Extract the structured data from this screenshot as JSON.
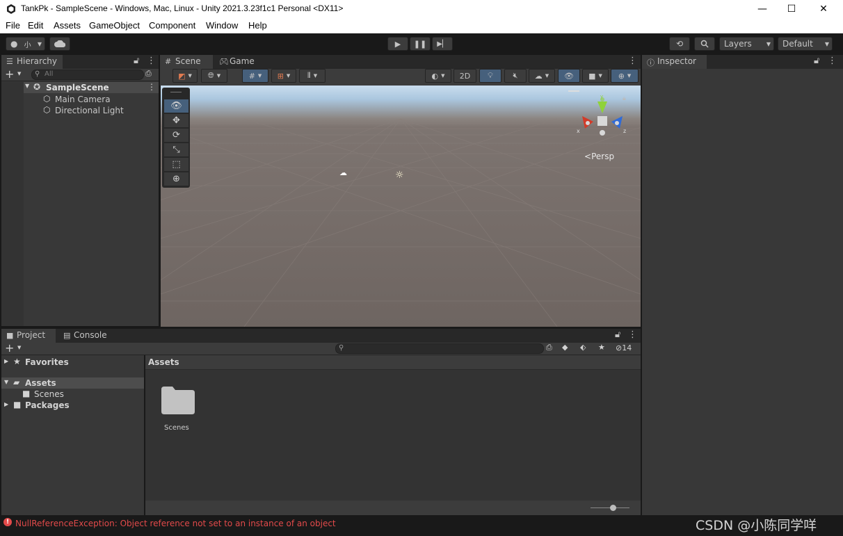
{
  "window": {
    "title": "TankPk - SampleScene - Windows, Mac, Linux - Unity 2021.3.23f1c1 Personal <DX11>",
    "minimize": "—",
    "maximize": "☐",
    "close": "✕"
  },
  "menu": [
    "File",
    "Edit",
    "Assets",
    "GameObject",
    "Component",
    "Window",
    "Help"
  ],
  "toolbar": {
    "account_label": "小",
    "layers": "Layers",
    "layout": "Default"
  },
  "hierarchy": {
    "tab": "Hierarchy",
    "search_placeholder": "All",
    "scene": "SampleScene",
    "items": [
      "Main Camera",
      "Directional Light"
    ]
  },
  "scene_view": {
    "tabs": [
      "Scene",
      "Game"
    ],
    "toggle_2d": "2D",
    "persp_label": "Persp",
    "gizmo_axes": {
      "x": "x",
      "y": "y",
      "z": "z"
    },
    "colors": {
      "x": "#d33a28",
      "y": "#8fd23a",
      "z": "#2f6bd8",
      "selected_tool": "#46607c"
    }
  },
  "inspector": {
    "tab": "Inspector"
  },
  "project": {
    "tabs": [
      "Project",
      "Console"
    ],
    "favorites": "Favorites",
    "assets": "Assets",
    "scenes": "Scenes",
    "packages": "Packages",
    "breadcrumb": "Assets",
    "hidden_count": "14",
    "folder_label": "Scenes"
  },
  "status": {
    "error_text": "NullReferenceException: Object reference not set to an instance of an object",
    "error_color": "#e24a4a",
    "watermark": "CSDN @小陈同学咩"
  }
}
